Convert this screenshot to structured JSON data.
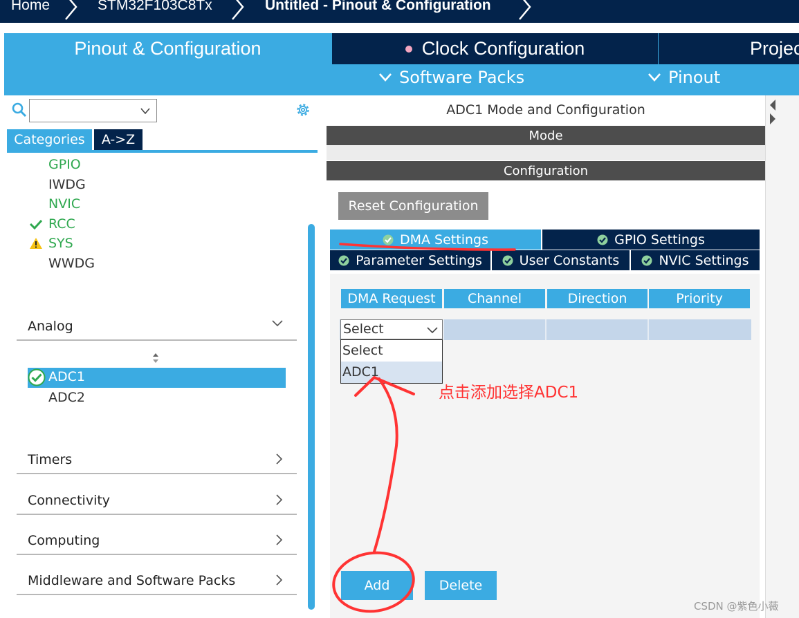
{
  "breadcrumb": {
    "home": "Home",
    "chip": "STM32F103C8Tx",
    "current": "Untitled - Pinout & Configuration"
  },
  "top_tabs": {
    "pinout": "Pinout & Configuration",
    "clock": "Clock Configuration",
    "project": "Projec"
  },
  "sub_tabs": {
    "software_packs": "Software Packs",
    "pinout": "Pinout"
  },
  "left": {
    "search_value": "",
    "category_tab": "Categories",
    "az_tab": "A->Z",
    "system_items": [
      {
        "label": "GPIO",
        "status": "green"
      },
      {
        "label": "IWDG",
        "status": "none"
      },
      {
        "label": "NVIC",
        "status": "green"
      },
      {
        "label": "RCC",
        "status": "check"
      },
      {
        "label": "SYS",
        "status": "warning"
      },
      {
        "label": "WWDG",
        "status": "none"
      }
    ],
    "sections": {
      "analog": "Analog",
      "timers": "Timers",
      "connectivity": "Connectivity",
      "computing": "Computing",
      "middleware": "Middleware and Software Packs"
    },
    "analog_items": {
      "adc1": "ADC1",
      "adc2": "ADC2"
    }
  },
  "right": {
    "title": "ADC1 Mode and Configuration",
    "mode_header": "Mode",
    "config_header": "Configuration",
    "reset_button": "Reset Configuration",
    "settings_tabs": {
      "dma": "DMA Settings",
      "gpio": "GPIO Settings",
      "parameter": "Parameter Settings",
      "user_constants": "User Constants",
      "nvic": "NVIC Settings"
    },
    "table_headers": [
      "DMA Request",
      "Channel",
      "Direction",
      "Priority"
    ],
    "select_value": "Select",
    "dropdown_options": [
      "Select",
      "ADC1"
    ],
    "add_button": "Add",
    "delete_button": "Delete"
  },
  "annotation": {
    "text": "点击添加选择ADC1",
    "color": "#ff3333"
  },
  "watermark": "CSDN @紫色小薇",
  "colors": {
    "navy": "#03234b",
    "accent": "#3babe2",
    "ok_green": "#2fa84f",
    "warning": "#f6c315",
    "annotation": "#ff3333"
  }
}
